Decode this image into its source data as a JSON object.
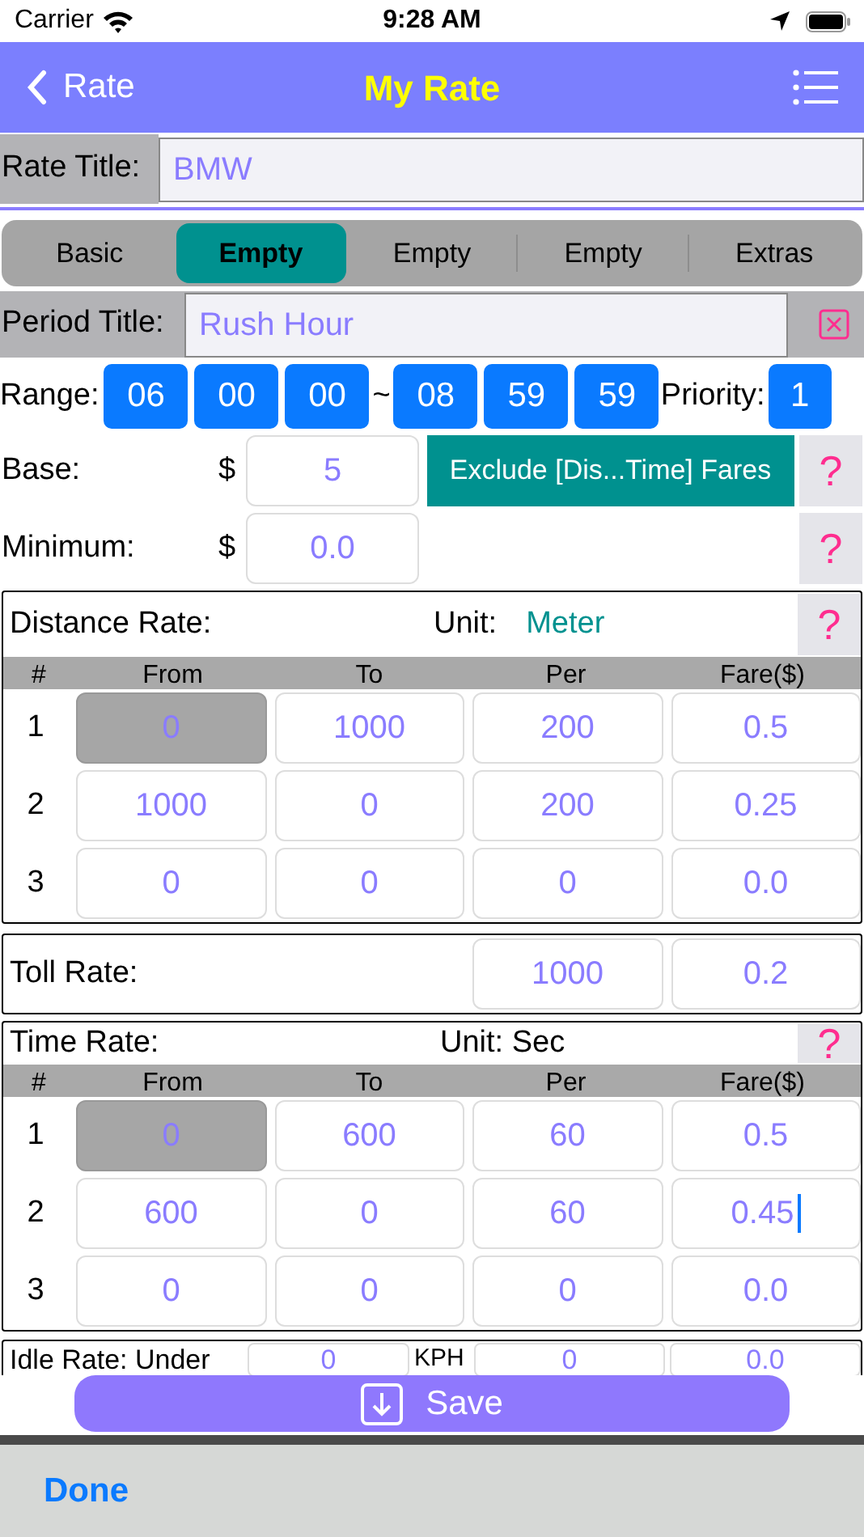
{
  "status_bar": {
    "carrier": "Carrier",
    "time": "9:28 AM"
  },
  "nav": {
    "back_label": "Rate",
    "title": "My Rate"
  },
  "rate_title": {
    "label": "Rate Title:",
    "value": "BMW"
  },
  "tabs": [
    {
      "label": "Basic",
      "selected": false
    },
    {
      "label": "Empty",
      "selected": true
    },
    {
      "label": "Empty",
      "selected": false
    },
    {
      "label": "Empty",
      "selected": false
    },
    {
      "label": "Extras",
      "selected": false
    }
  ],
  "period": {
    "label": "Period Title:",
    "value": "Rush Hour"
  },
  "range": {
    "label": "Range:",
    "start": [
      "06",
      "00",
      "00"
    ],
    "separator": "~",
    "end": [
      "08",
      "59",
      "59"
    ],
    "priority_label": "Priority:",
    "priority": "1"
  },
  "base": {
    "label": "Base:",
    "currency": "$",
    "value": "5",
    "exclude_button": "Exclude [Dis...Time] Fares",
    "help": "?"
  },
  "minimum": {
    "label": "Minimum:",
    "currency": "$",
    "value": "0.0",
    "help": "?"
  },
  "distance": {
    "label": "Distance Rate:",
    "unit_label": "Unit:",
    "unit_value": "Meter",
    "help": "?",
    "columns": [
      "#",
      "From",
      "To",
      "Per",
      "Fare($)"
    ],
    "rows": [
      {
        "index": "1",
        "from": "0",
        "to": "1000",
        "per": "200",
        "fare": "0.5",
        "from_locked": true,
        "fare_focused": false
      },
      {
        "index": "2",
        "from": "1000",
        "to": "0",
        "per": "200",
        "fare": "0.25",
        "from_locked": false,
        "fare_focused": false
      },
      {
        "index": "3",
        "from": "0",
        "to": "0",
        "per": "0",
        "fare": "0.0",
        "from_locked": false,
        "fare_focused": false
      }
    ]
  },
  "toll": {
    "label": "Toll Rate:",
    "per": "1000",
    "fare": "0.2"
  },
  "time": {
    "label": "Time Rate:",
    "unit": "Unit: Sec",
    "help": "?",
    "columns": [
      "#",
      "From",
      "To",
      "Per",
      "Fare($)"
    ],
    "rows": [
      {
        "index": "1",
        "from": "0",
        "to": "600",
        "per": "60",
        "fare": "0.5",
        "from_locked": true,
        "fare_focused": false
      },
      {
        "index": "2",
        "from": "600",
        "to": "0",
        "per": "60",
        "fare": "0.45",
        "from_locked": false,
        "fare_focused": true
      },
      {
        "index": "3",
        "from": "0",
        "to": "0",
        "per": "0",
        "fare": "0.0",
        "from_locked": false,
        "fare_focused": false
      }
    ]
  },
  "idle": {
    "label": "Idle Rate: Under",
    "value": "0",
    "unit": "KPH",
    "per": "0",
    "fare": "0.0"
  },
  "save": {
    "label": "Save"
  },
  "toolbar": {
    "done": "Done"
  }
}
